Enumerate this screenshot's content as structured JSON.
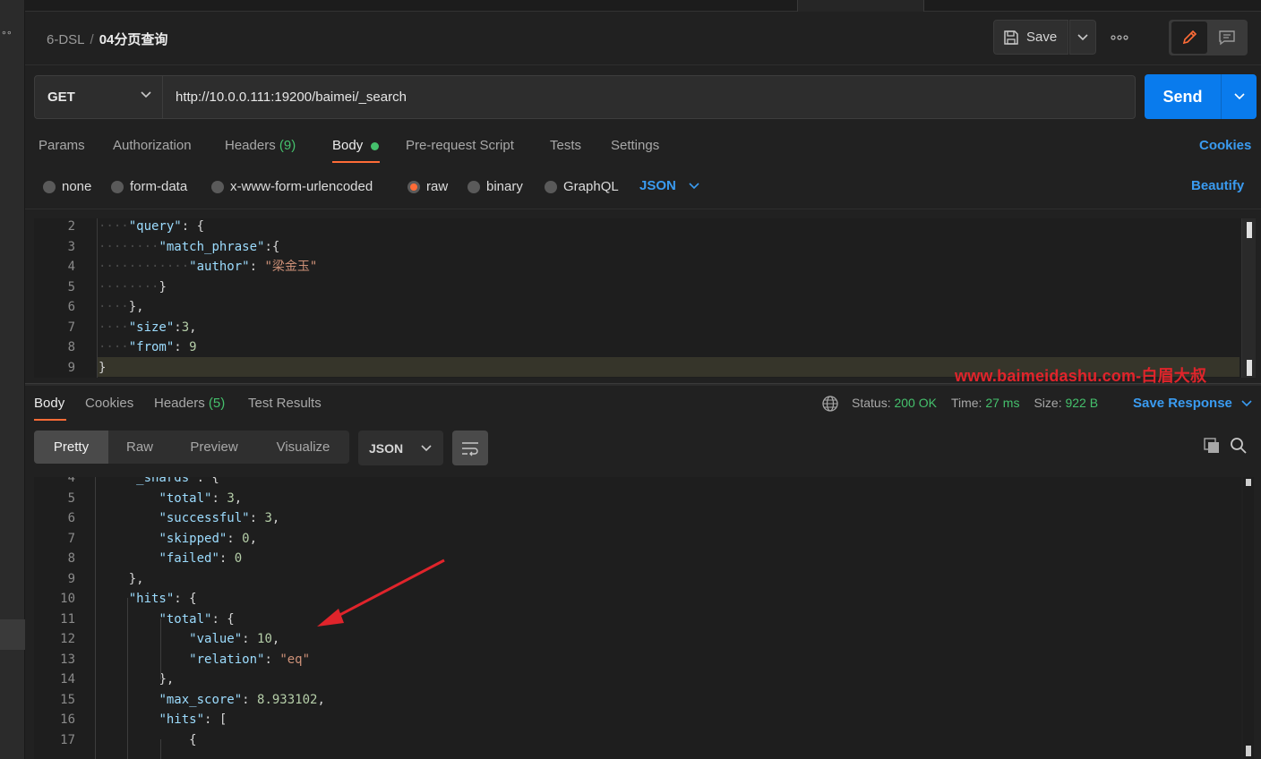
{
  "header": {
    "collection": "6-DSL",
    "separator": "/",
    "request_name": "04分页查询",
    "save_label": "Save",
    "more_icon": "ellipsis-icon"
  },
  "request": {
    "method": "GET",
    "url": "http://10.0.0.111:19200/baimei/_search",
    "send_label": "Send"
  },
  "request_tabs": {
    "params": "Params",
    "authorization": "Authorization",
    "headers": "Headers",
    "headers_count": "(9)",
    "body": "Body",
    "pre_request": "Pre-request Script",
    "tests": "Tests",
    "settings": "Settings",
    "cookies": "Cookies"
  },
  "body_types": {
    "none": "none",
    "form_data": "form-data",
    "urlencoded": "x-www-form-urlencoded",
    "raw": "raw",
    "binary": "binary",
    "graphql": "GraphQL",
    "format": "JSON",
    "beautify": "Beautify"
  },
  "request_body_lines": [
    {
      "n": "2",
      "indent": 1,
      "key": "\"query\"",
      "rest": ": {"
    },
    {
      "n": "3",
      "indent": 2,
      "key": "\"match_phrase\"",
      "rest": ":{"
    },
    {
      "n": "4",
      "indent": 3,
      "key": "\"author\"",
      "rest": ": ",
      "str": "\"梁金玉\""
    },
    {
      "n": "5",
      "indent": 2,
      "key": "",
      "rest": "}"
    },
    {
      "n": "6",
      "indent": 1,
      "key": "",
      "rest": "},"
    },
    {
      "n": "7",
      "indent": 1,
      "key": "\"size\"",
      "rest": ":",
      "num": "3",
      "tail": ","
    },
    {
      "n": "8",
      "indent": 1,
      "key": "\"from\"",
      "rest": ": ",
      "num": "9"
    },
    {
      "n": "9",
      "indent": 0,
      "key": "",
      "rest": "}"
    }
  ],
  "watermark": "www.baimeidashu.com-白眉大叔",
  "response_tabs": {
    "body": "Body",
    "cookies": "Cookies",
    "headers": "Headers",
    "headers_count": "(5)",
    "test_results": "Test Results"
  },
  "response_status": {
    "status_label": "Status:",
    "status_value": "200 OK",
    "time_label": "Time:",
    "time_value": "27 ms",
    "size_label": "Size:",
    "size_value": "922 B",
    "save_response": "Save Response"
  },
  "response_view": {
    "pretty": "Pretty",
    "raw": "Raw",
    "preview": "Preview",
    "visualize": "Visualize",
    "format": "JSON"
  },
  "response_body_lines": [
    {
      "n": "4",
      "indent": 1,
      "key": "\"_shards\"",
      "rest": ": {"
    },
    {
      "n": "5",
      "indent": 2,
      "key": "\"total\"",
      "rest": ": ",
      "num": "3",
      "tail": ","
    },
    {
      "n": "6",
      "indent": 2,
      "key": "\"successful\"",
      "rest": ": ",
      "num": "3",
      "tail": ","
    },
    {
      "n": "7",
      "indent": 2,
      "key": "\"skipped\"",
      "rest": ": ",
      "num": "0",
      "tail": ","
    },
    {
      "n": "8",
      "indent": 2,
      "key": "\"failed\"",
      "rest": ": ",
      "num": "0"
    },
    {
      "n": "9",
      "indent": 1,
      "key": "",
      "rest": "},"
    },
    {
      "n": "10",
      "indent": 1,
      "key": "\"hits\"",
      "rest": ": {"
    },
    {
      "n": "11",
      "indent": 2,
      "key": "\"total\"",
      "rest": ": {"
    },
    {
      "n": "12",
      "indent": 3,
      "key": "\"value\"",
      "rest": ": ",
      "num": "10",
      "tail": ","
    },
    {
      "n": "13",
      "indent": 3,
      "key": "\"relation\"",
      "rest": ": ",
      "str": "\"eq\""
    },
    {
      "n": "14",
      "indent": 2,
      "key": "",
      "rest": "},"
    },
    {
      "n": "15",
      "indent": 2,
      "key": "\"max_score\"",
      "rest": ": ",
      "num": "8.933102",
      "tail": ","
    },
    {
      "n": "16",
      "indent": 2,
      "key": "\"hits\"",
      "rest": ": ["
    },
    {
      "n": "17",
      "indent": 3,
      "key": "",
      "rest": "{"
    }
  ],
  "colors": {
    "accent_orange": "#ff6c37",
    "send_blue": "#097bed",
    "link_blue": "#3a9bf0",
    "status_green": "#45c06c",
    "arrow_red": "#e0242b"
  }
}
